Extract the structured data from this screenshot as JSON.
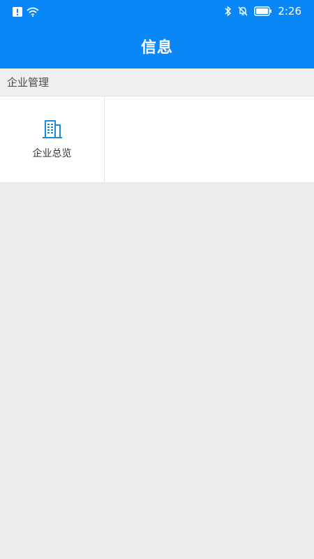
{
  "statusbar": {
    "time": "2:26",
    "icons": [
      "alert-icon",
      "wifi-icon",
      "bluetooth-icon",
      "mute-bell-icon",
      "battery-icon"
    ]
  },
  "header": {
    "title": "信息",
    "color": "#0a87f7"
  },
  "section": {
    "title": "企业管理"
  },
  "tiles": [
    {
      "label": "企业总览",
      "icon": "building-icon",
      "icon_color": "#1a8ad6"
    }
  ]
}
